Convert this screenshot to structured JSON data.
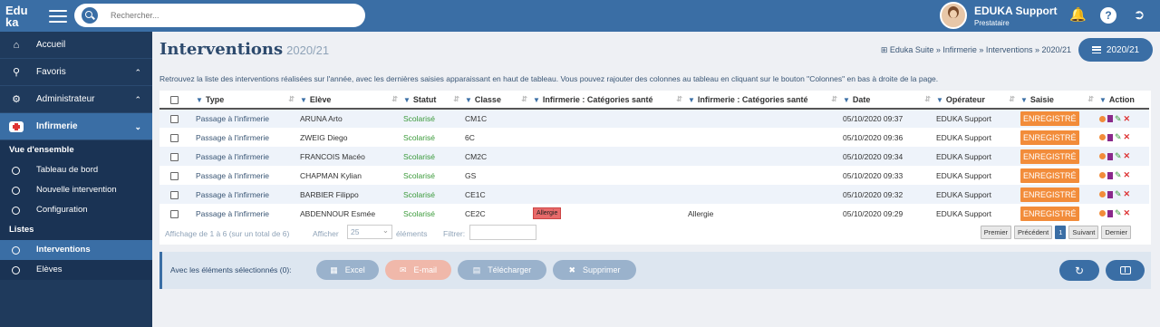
{
  "app": {
    "logo_line1": "Edu",
    "logo_line2": "ka"
  },
  "search": {
    "placeholder": "Rechercher..."
  },
  "user": {
    "name": "EDUKA Support",
    "role": "Prestataire"
  },
  "sidebar": {
    "items": [
      {
        "label": "Accueil",
        "icon": "home-icon"
      },
      {
        "label": "Favoris",
        "icon": "pin-icon"
      },
      {
        "label": "Administrateur",
        "icon": "admin-icon"
      },
      {
        "label": "Infirmerie",
        "icon": "nurse-icon"
      }
    ],
    "section1": "Vue d'ensemble",
    "links1": [
      "Tableau de bord",
      "Nouvelle intervention",
      "Configuration"
    ],
    "section2": "Listes",
    "links2": [
      "Interventions",
      "Elèves"
    ]
  },
  "page": {
    "title": "Interventions",
    "year": "2020/21",
    "breadcrumb": "Eduka Suite » Infirmerie » Interventions » 2020/21",
    "year_button": "2020/21",
    "description": "Retrouvez la liste des interventions réalisées sur l'année, avec les dernières saisies apparaissant en haut de tableau. Vous pouvez rajouter des colonnes au tableau en cliquant sur le bouton \"Colonnes\" en bas à droite de la page."
  },
  "table": {
    "headers": [
      "Type",
      "Elève",
      "Statut",
      "Classe",
      "Infirmerie : Catégories santé",
      "Infirmerie : Catégories santé",
      "Date",
      "Opérateur",
      "Saisie",
      "Action"
    ],
    "rows": [
      {
        "type": "Passage à l'infirmerie",
        "eleve": "ARUNA Arto",
        "statut": "Scolarisé",
        "classe": "CM1C",
        "cat1": "",
        "cat2": "",
        "date": "05/10/2020 09:37",
        "operateur": "EDUKA Support",
        "saisie": "ENREGISTRÉ"
      },
      {
        "type": "Passage à l'infirmerie",
        "eleve": "ZWEIG Diego",
        "statut": "Scolarisé",
        "classe": "6C",
        "cat1": "",
        "cat2": "",
        "date": "05/10/2020 09:36",
        "operateur": "EDUKA Support",
        "saisie": "ENREGISTRÉ"
      },
      {
        "type": "Passage à l'infirmerie",
        "eleve": "FRANCOIS Macéo",
        "statut": "Scolarisé",
        "classe": "CM2C",
        "cat1": "",
        "cat2": "",
        "date": "05/10/2020 09:34",
        "operateur": "EDUKA Support",
        "saisie": "ENREGISTRÉ"
      },
      {
        "type": "Passage à l'infirmerie",
        "eleve": "CHAPMAN Kylian",
        "statut": "Scolarisé",
        "classe": "GS",
        "cat1": "",
        "cat2": "",
        "date": "05/10/2020 09:33",
        "operateur": "EDUKA Support",
        "saisie": "ENREGISTRÉ"
      },
      {
        "type": "Passage à l'infirmerie",
        "eleve": "BARBIER Filippo",
        "statut": "Scolarisé",
        "classe": "CE1C",
        "cat1": "",
        "cat2": "",
        "date": "05/10/2020 09:32",
        "operateur": "EDUKA Support",
        "saisie": "ENREGISTRÉ"
      },
      {
        "type": "Passage à l'infirmerie",
        "eleve": "ABDENNOUR Esmée",
        "statut": "Scolarisé",
        "classe": "CE2C",
        "cat1": "Allergie",
        "cat2": "Allergie",
        "date": "05/10/2020 09:29",
        "operateur": "EDUKA Support",
        "saisie": "ENREGISTRÉ"
      }
    ]
  },
  "footer": {
    "info": "Affichage de 1 à 6 (sur un total de 6)",
    "show_label": "Afficher",
    "show_value": "25",
    "elements_label": "éléments",
    "filter_label": "Filtrer:",
    "pager": [
      "Premier",
      "Précédent",
      "1",
      "Suivant",
      "Dernier"
    ]
  },
  "bulk": {
    "label": "Avec les éléments sélectionnés (0):",
    "excel": "Excel",
    "email": "E-mail",
    "download": "Télécharger",
    "delete": "Supprimer"
  },
  "colors": {
    "primary": "#3a6ea5",
    "sidebar": "#1f3a5c",
    "saisie": "#f28c3a",
    "allergie": "#e86a6a"
  }
}
